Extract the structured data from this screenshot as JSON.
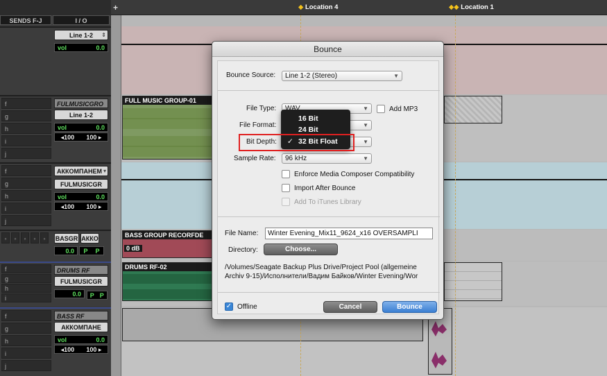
{
  "ruler": {
    "markers": [
      {
        "label": "Location 4"
      },
      {
        "label": "Location 1"
      }
    ]
  },
  "mixer": {
    "headers": {
      "sends": "SENDS F-J",
      "io": "I / O"
    },
    "strips": [
      {
        "sends": [],
        "io_name": "",
        "output": "Line 1-2",
        "vol_label": "vol",
        "vol_value": "0.0",
        "pan_left": "",
        "pan_right": ""
      },
      {
        "sends": [
          "f",
          "g",
          "h",
          "i",
          "j"
        ],
        "io_name": "FULMUSICGRO",
        "output": "Line 1-2",
        "vol_label": "vol",
        "vol_value": "0.0",
        "pan_left": "◂100",
        "pan_right": "100 ▸"
      },
      {
        "sends": [
          "f",
          "g",
          "h",
          "i",
          "j"
        ],
        "io_name": "АККОМПАНЕМ",
        "output": "FULMUSICGR",
        "vol_label": "vol",
        "vol_value": "0.0",
        "pan_left": "◂100",
        "pan_right": "100 ▸"
      },
      {
        "sends": [],
        "io_name": "",
        "output": "BASGR",
        "output2": "АККО",
        "vol_label": "",
        "vol_value": "0.0",
        "pan_left": "P",
        "pan_right": "P"
      },
      {
        "sends": [
          "f",
          "g",
          "h",
          "i",
          "j"
        ],
        "io_name": "DRUMS RF",
        "output": "FULMUSICGR",
        "vol_label": "",
        "vol_value": "0.0",
        "pan_left": "P",
        "pan_right": "P"
      },
      {
        "sends": [
          "f",
          "g",
          "h",
          "i",
          "j"
        ],
        "io_name": "BASS RF",
        "output": "АККОМПАНЕ",
        "vol_label": "vol",
        "vol_value": "0.0",
        "pan_left": "◂100",
        "pan_right": "100 ▸"
      }
    ]
  },
  "clips": {
    "full_music": "FULL MUSIC GROUP-01",
    "bass_group": "BASS GROUP RECORFDE",
    "bass_gain": "0 dB",
    "drums": "DRUMS RF-02"
  },
  "dialog": {
    "title": "Bounce",
    "bounce_source_label": "Bounce Source:",
    "bounce_source_value": "Line 1-2 (Stereo)",
    "file_type_label": "File Type:",
    "file_type_value": "WAV",
    "add_mp3_label": "Add MP3",
    "file_format_label": "File Format:",
    "bit_depth_label": "Bit Depth:",
    "sample_rate_label": "Sample Rate:",
    "sample_rate_value": "96 kHz",
    "enforce_label": "Enforce Media Composer Compatibility",
    "import_label": "Import After Bounce",
    "itunes_label": "Add To iTunes Library",
    "file_name_label": "File Name:",
    "file_name_value": "Winter Evening_Mix11_9624_x16 OVERSAMPLI",
    "directory_label": "Directory:",
    "choose_label": "Choose...",
    "directory_line1": "/Volumes/Seagate Backup Plus Drive/Project Pool (allgemeine",
    "directory_line2": "Archiv 9-15)/Исполнители/Вадим Байков/Winter Evening/Wor",
    "offline_label": "Offline",
    "cancel_label": "Cancel",
    "bounce_label": "Bounce"
  },
  "bit_depth_menu": {
    "items": [
      {
        "label": "16 Bit",
        "checked": false
      },
      {
        "label": "24 Bit",
        "checked": false
      },
      {
        "label": "32 Bit Float",
        "checked": true
      }
    ],
    "check_glyph": "✓"
  }
}
